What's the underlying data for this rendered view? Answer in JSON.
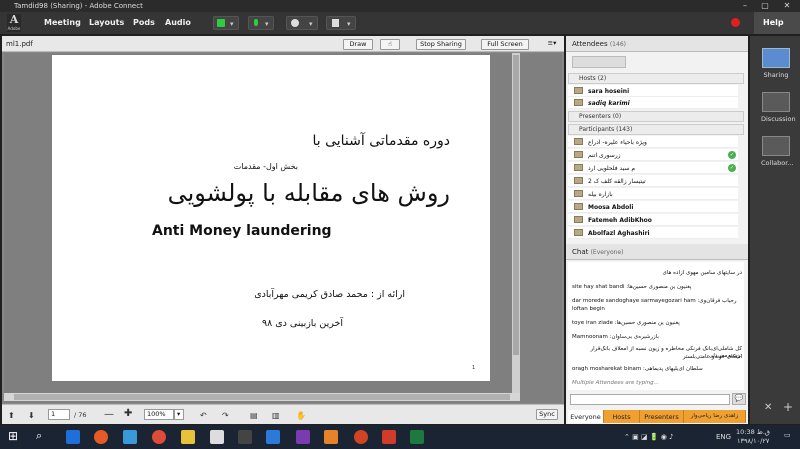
{
  "window": {
    "title": "Tamdid98 (Sharing) - Adobe Connect"
  },
  "app": {
    "logo_letter": "A",
    "logo_text": "Adobe"
  },
  "menu": [
    "Meeting",
    "Layouts",
    "Pods",
    "Audio"
  ],
  "help": "Help",
  "share_pod": {
    "filename": "ml1.pdf",
    "buttons": {
      "draw": "Draw",
      "stop": "Stop Sharing",
      "fullscreen": "Full Screen"
    },
    "page_current": "1",
    "page_total": "/ 76",
    "zoom": "100%",
    "sync": "Sync"
  },
  "slide": {
    "line1": "دوره مقدماتی آشنایی با",
    "line2": "بخش اول- مقدمات",
    "line3": "روش های مقابله با پولشویی",
    "line4": "Anti Money laundering",
    "line5": "ارائه از : محمد صادق کریمی مهرآبادی",
    "line6": "آخرین بازبینی دی ۹۸",
    "page_num": "1"
  },
  "attendees": {
    "title": "Attendees",
    "count": "(146)",
    "hosts_label": "Hosts (2)",
    "hosts": [
      "sara hoseini",
      "sadiq karimi"
    ],
    "presenters_label": "Presenters (0)",
    "participants_label": "Participants (143)",
    "participants": [
      "ویژه باحیاء علیره- ادراع",
      "زرسوری اتنم",
      "م سید فلحلویی ارد",
      "2 تیتیسار زالقه کلف ک",
      "بازاره بیله",
      "Moosa Abdoli",
      "Fatemeh AdibKhoo",
      "Abolfazl Aghashiri"
    ]
  },
  "chat": {
    "title": "Chat",
    "scope": "(Everyone)",
    "messages": [
      "در سایتهای سامین مهوی ازاده های",
      "site hay shat bandi :پغنیون ین منصوری حسین‌ها",
      "dar morede sandoghaye sarmayegozari ham :رحیاب فرقان‌وی",
      "loftan begin",
      "toye iran ziade :پغنیون ین منصوری حسین‌ها",
      "Mamnoonam :بازرشیره‌ی بی‌ساوان",
      "کل شاملی‌ای‌بانک فرنکی مخاطره و زیون نسبه از امعلاف بانک‌قرار ترسیم‌معی‌دلی",
      "اشکای خونه‌و عامتی‌بلستر",
      "oragh mosharekat binam :سلطان ای‌یلیها‌ی پدیماهی"
    ],
    "typing": "Multiple Attendees are typing...",
    "tabs": [
      "Everyone",
      "Hosts",
      "Presenters",
      "زاهدی رضا ریاحی‌وار"
    ]
  },
  "layouts": [
    "Sharing",
    "Discussion",
    "Collabor..."
  ],
  "taskbar": {
    "lang": "ENG",
    "time": "10:38 ق.ظ",
    "date": "۱۳۹۸/۱۰/۲۷"
  }
}
